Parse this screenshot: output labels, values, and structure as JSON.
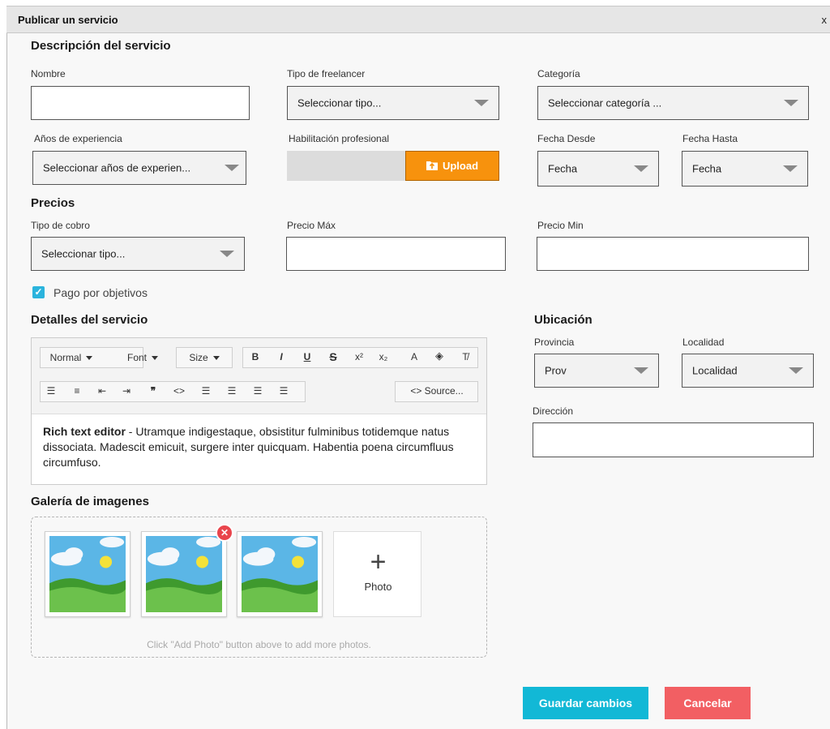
{
  "window": {
    "title": "Publicar un servicio",
    "close": "x"
  },
  "descripcion": {
    "heading": "Descripción del servicio",
    "nombre_label": "Nombre",
    "nombre_value": "",
    "tipo_freelancer_label": "Tipo de freelancer",
    "tipo_freelancer_value": "Seleccionar tipo...",
    "categoria_label": "Categoría",
    "categoria_value": "Seleccionar categoría ...",
    "anios_label": "Años de experiencia",
    "anios_value": "Seleccionar años de experien...",
    "habilitacion_label": "Habilitación profesional",
    "upload_label": "Upload",
    "fecha_desde_label": "Fecha Desde",
    "fecha_desde_value": "Fecha",
    "fecha_hasta_label": "Fecha Hasta",
    "fecha_hasta_value": "Fecha"
  },
  "precios": {
    "heading": "Precios",
    "tipo_cobro_label": "Tipo de cobro",
    "tipo_cobro_value": "Seleccionar tipo...",
    "precio_max_label": "Precio Máx",
    "precio_min_label": "Precio Min",
    "pago_objetivos_label": "Pago por objetivos",
    "pago_objetivos_checked": true
  },
  "detalles": {
    "heading": "Detalles del servicio",
    "toolbar": {
      "format": "Normal",
      "font": "Font",
      "size": "Size",
      "source": "<> Source..."
    },
    "content_bold": "Rich text editor",
    "content_rest": " - Utramque indigestaque, obsistitur fulminibus totidemque natus dissociata. Madescit emicuit, surgere inter quicquam. Habentia poena circumfluus circumfuso."
  },
  "ubicacion": {
    "heading": "Ubicación",
    "provincia_label": "Provincia",
    "provincia_value": "Prov",
    "localidad_label": "Localidad",
    "localidad_value": "Localidad",
    "direccion_label": "Dirección",
    "direccion_value": ""
  },
  "galeria": {
    "heading": "Galería de imagenes",
    "photo_count": 3,
    "add_photo_label": "Photo",
    "hint": "Click \"Add Photo\" button above to add more photos."
  },
  "actions": {
    "save": "Guardar cambios",
    "cancel": "Cancelar"
  },
  "colors": {
    "upload": "#f7920d",
    "save": "#12b8d6",
    "cancel": "#f25f63",
    "checkbox": "#2bb4dd"
  }
}
